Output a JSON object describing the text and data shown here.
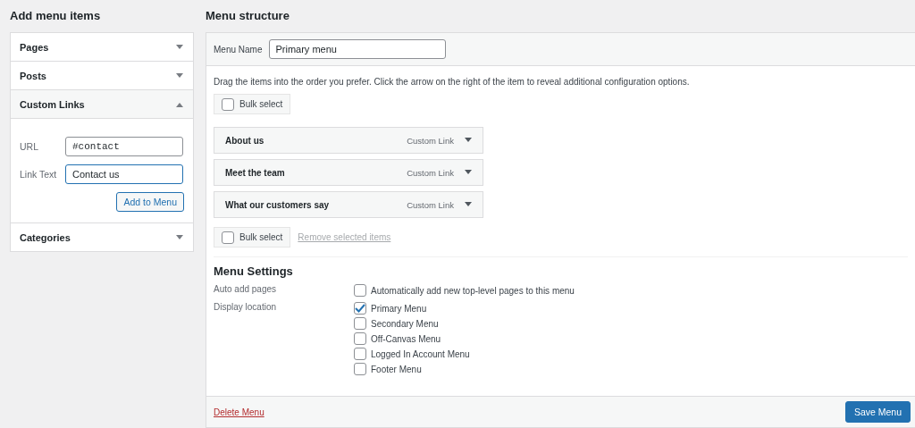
{
  "add_items": {
    "title": "Add menu items",
    "sections": [
      {
        "label": "Pages",
        "expanded": false
      },
      {
        "label": "Posts",
        "expanded": false
      },
      {
        "label": "Custom Links",
        "expanded": true,
        "fields": [
          {
            "label": "URL",
            "value": "#contact",
            "kind": "url",
            "focused": false
          },
          {
            "label": "Link Text",
            "value": "Contact us",
            "kind": "text",
            "focused": true
          }
        ],
        "button": "Add to Menu"
      },
      {
        "label": "Categories",
        "expanded": false
      }
    ]
  },
  "structure": {
    "title": "Menu structure",
    "menu_name": {
      "label": "Menu Name",
      "value": "Primary menu"
    },
    "instructions": "Drag the items into the order you prefer. Click the arrow on the right of the item to reveal additional configuration options.",
    "bulk_select_top": {
      "label": "Bulk select",
      "checked": false
    },
    "items": [
      {
        "title": "About us",
        "type": "Custom Link"
      },
      {
        "title": "Meet the team",
        "type": "Custom Link"
      },
      {
        "title": "What our customers say",
        "type": "Custom Link"
      }
    ],
    "bulk_select_bottom": {
      "label": "Bulk select",
      "checked": false
    },
    "remove_link": "Remove selected items",
    "settings": {
      "title": "Menu Settings",
      "rows": [
        {
          "label": "Auto add pages",
          "options": [
            {
              "label": "Automatically add new top-level pages to this menu",
              "checked": false
            }
          ]
        },
        {
          "label": "Display location",
          "options": [
            {
              "label": "Primary Menu",
              "checked": true
            },
            {
              "label": "Secondary Menu",
              "checked": false
            },
            {
              "label": "Off-Canvas Menu",
              "checked": false
            },
            {
              "label": "Logged In Account Menu",
              "checked": false
            },
            {
              "label": "Footer Menu",
              "checked": false
            }
          ]
        }
      ]
    },
    "footer": {
      "delete": "Delete Menu",
      "save": "Save Menu"
    }
  }
}
